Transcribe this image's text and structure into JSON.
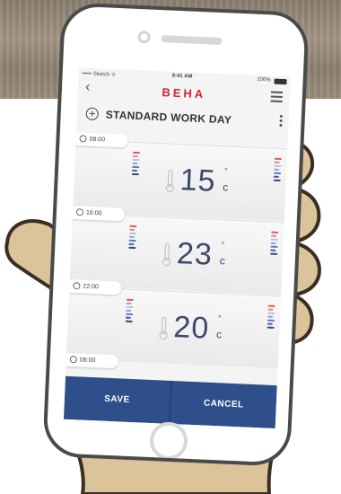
{
  "status_bar": {
    "carrier": "••••• Sketch ᯤ",
    "time": "9:41 AM",
    "battery": "100%"
  },
  "navbar": {
    "back_icon": "‹",
    "logo": "BEHA",
    "logo_color": "#d0262e"
  },
  "header": {
    "title": "STANDARD WORK DAY",
    "add_icon": "+"
  },
  "schedule": {
    "time_tags": [
      "08:00",
      "16:00",
      "22:00",
      "08:00"
    ],
    "temperatures": [
      {
        "value": "15",
        "unit": "c"
      },
      {
        "value": "23",
        "unit": "c"
      },
      {
        "value": "20",
        "unit": "c"
      }
    ]
  },
  "buttons": {
    "save": "SAVE",
    "cancel": "CANCEL",
    "color": "#2f4f8a"
  }
}
